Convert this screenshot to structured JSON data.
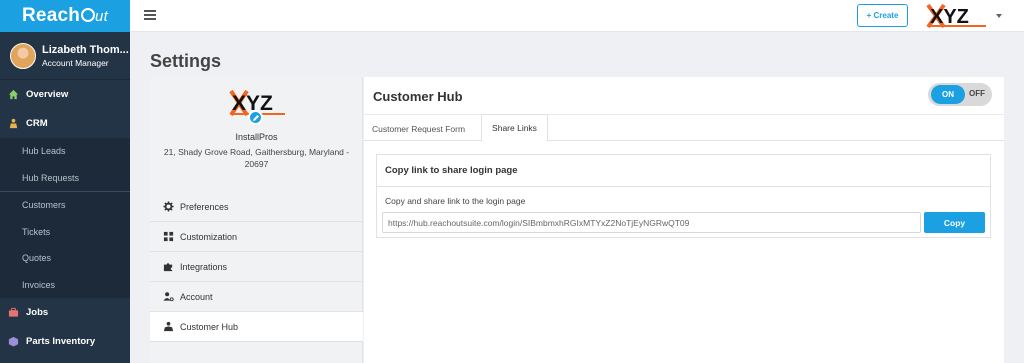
{
  "brand": {
    "name_prefix": "Reach",
    "name_suffix": "ut"
  },
  "user": {
    "name": "Lizabeth Thom...",
    "role": "Account Manager"
  },
  "sidebar": {
    "overview": "Overview",
    "crm": "CRM",
    "crm_items": [
      "Hub Leads",
      "Hub Requests"
    ],
    "crm_items2": [
      "Customers",
      "Tickets",
      "Quotes",
      "Invoices"
    ],
    "jobs": "Jobs",
    "parts": "Parts Inventory"
  },
  "topbar": {
    "create_label": "+ Create",
    "company_logo_text": "XYZ"
  },
  "page": {
    "title": "Settings"
  },
  "company": {
    "logo_text": "XYZ",
    "name": "InstallPros",
    "address": "21, Shady Grove Road, Gaithersburg, Maryland - 20697"
  },
  "settings_menu": [
    {
      "label": "Preferences",
      "icon": "gear-icon"
    },
    {
      "label": "Customization",
      "icon": "grid-icon"
    },
    {
      "label": "Integrations",
      "icon": "puzzle-icon"
    },
    {
      "label": "Account",
      "icon": "user-gear-icon"
    },
    {
      "label": "Customer Hub",
      "icon": "hub-icon"
    }
  ],
  "hub": {
    "title": "Customer Hub",
    "toggle_on": "ON",
    "toggle_off": "OFF",
    "tabs": [
      "Customer Request Form",
      "Share Links"
    ],
    "share_heading": "Copy link to share login page",
    "share_description": "Copy and share link to the login page",
    "share_link": "https://hub.reachoutsuite.com/login/SIBmbmxhRGIxMTYxZ2NoTjEyNGRwQT09",
    "copy_label": "Copy"
  },
  "colors": {
    "accent": "#1ba0e2",
    "sidebar": "#243447",
    "logo_orange": "#f26522"
  }
}
